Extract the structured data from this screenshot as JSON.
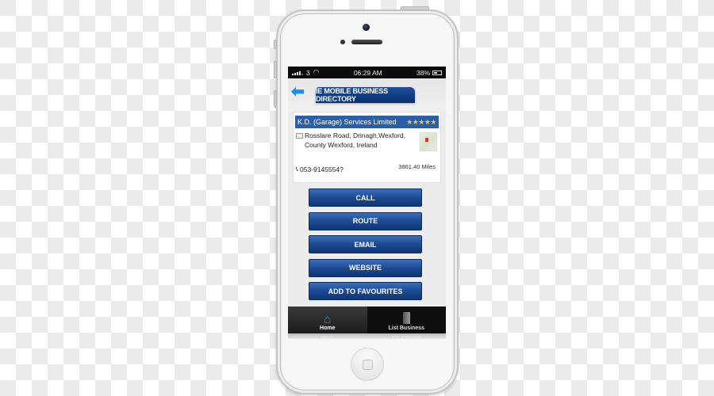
{
  "status_bar": {
    "carrier": "3",
    "time": "06:29 AM",
    "battery": "38%"
  },
  "header": {
    "title": "IE MOBILE BUSINESS DIRECTORY",
    "back_icon": "back-arrow-icon"
  },
  "business": {
    "name": "K.D. (Garage) Services Limited",
    "rating": 5,
    "rating_display": "★★★★★",
    "address_line1": "Rosslare Road, Drinagh,Wexford,",
    "address_line2": "County Wexford,  Ireland",
    "phone": "053-9145554?",
    "distance": "3861.40 Miles"
  },
  "actions": [
    {
      "label": "CALL"
    },
    {
      "label": "ROUTE"
    },
    {
      "label": "EMAIL"
    },
    {
      "label": "WEBSITE"
    },
    {
      "label": "ADD TO FAVOURITES"
    }
  ],
  "tabbar": {
    "tabs": [
      {
        "label": "Home",
        "icon": "home-icon",
        "active": true
      },
      {
        "label": "List Business",
        "icon": "book-icon",
        "active": false
      }
    ]
  },
  "colors": {
    "brand_blue": "#1d4a92",
    "header_blue": "#2a5fa8",
    "accent_arrow": "#1a8cf0",
    "star": "#f2c53a"
  }
}
